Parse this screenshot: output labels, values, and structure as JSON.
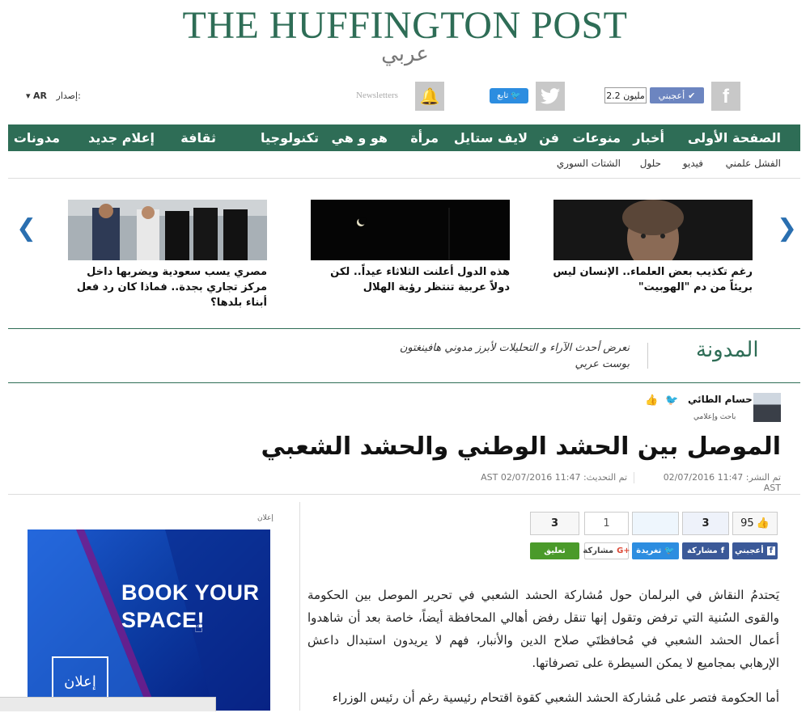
{
  "masthead": {
    "title": "THE HUFFINGTON POST",
    "subtitle": "عربي"
  },
  "social": {
    "like_label": "أعجبني",
    "like_count": "2.2 مليون",
    "follow_label": "تابع",
    "newsletters": "Newsletters",
    "edition_label": "إصدار:",
    "edition_value": "AR"
  },
  "nav": [
    "الصفحة الأولى",
    "أخبار",
    "منوعات",
    "فن",
    "لايف ستايل",
    "مرأة",
    "هو و هي",
    "تكنولوجيا",
    "ثقافة",
    "إعلام جديد",
    "مدونات"
  ],
  "subnav": [
    "الفشل علمني",
    "فيديو",
    "حلول",
    "الشتات السوري"
  ],
  "carousel": [
    {
      "caption": "رغم تكذيب بعض العلماء.. الإنسان ليس بريئاً من دم \"الهوبيت\""
    },
    {
      "caption": "هذه الدول أعلنت الثلاثاء عيداً.. لكن دولاً عربية تنتظر رؤية الهلال"
    },
    {
      "caption": "مصري يسب سعودية ويضربها داخل مركز تجاري بجدة.. فماذا كان رد فعل أبناء بلدها؟"
    }
  ],
  "blog": {
    "title": "المدونة",
    "description": "نعرض أحدث الآراء و التحليلات لأبرز مدوني هافينغتون بوست عربي"
  },
  "author": {
    "name": "حسام الطائي",
    "role": "باحث وإعلامي"
  },
  "article": {
    "title": "الموصل بين الحشد الوطني والحشد الشعبي",
    "published": "تم النشر: 11:47 02/07/2016 AST",
    "updated": "تم التحديث: 11:47 02/07/2016 AST",
    "paragraphs": [
      "يَحتدمُ النقاش في البرلمان حول مُشاركة الحشد الشعبي في تحرير الموصل بين الحكومة والقوى السُنية التي ترفض وتقول إنها تنقل رفض أهالي المحافظة أيضاً، خاصة بعد أن شاهدوا أعمال الحشد الشعبي في مُحافظتَي صلاح الدين والأنبار، فهم لا يريدون استبدال داعش الإرهابي بمجاميع لا يمكن السيطرة على تصرفاتها.",
      "أما الحكومة فتصر على مُشاركة الحشد الشعبي كقوة اقتحام رئيسية رغم أن رئيس الوزراء"
    ]
  },
  "share": {
    "fb_like_count": "95",
    "fb_share_count": "3",
    "tweet_count": "",
    "gplus_count": "1",
    "comment_count": "3",
    "fb_like_label": "أعجبني",
    "fb_share_label": "مشاركة",
    "tweet_label": "تغريدة",
    "gplus_label": "مشاركة",
    "comment_label": "تعليق"
  },
  "ad": {
    "label": "إعلان",
    "headline_line1": "BOOK YOUR",
    "headline_line2": "SPACE!",
    "logo_text": "إعلان"
  },
  "colors": {
    "brand_green": "#2e6d56",
    "facebook": "#3b5998",
    "twitter": "#2c8de0",
    "comment": "#4a9a2a"
  }
}
